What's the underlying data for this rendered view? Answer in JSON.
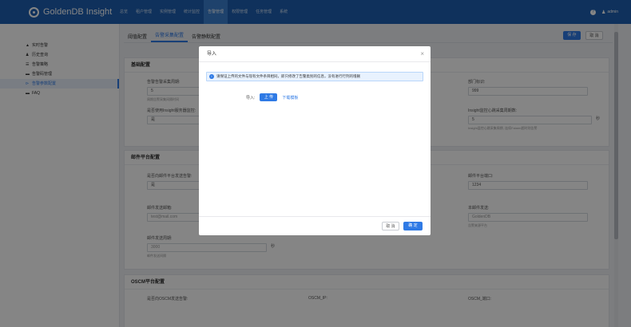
{
  "app": {
    "title": "GoldenDB Insight"
  },
  "nav": {
    "items": [
      {
        "label": "总览"
      },
      {
        "label": "租户管理"
      },
      {
        "label": "实例管理"
      },
      {
        "label": "统计监控"
      },
      {
        "label": "告警管理"
      },
      {
        "label": "权限管理"
      },
      {
        "label": "任务管理"
      },
      {
        "label": "系统"
      }
    ],
    "active_index": 4
  },
  "user": {
    "name": "admin"
  },
  "sidebar": {
    "items": [
      {
        "icon": "▲",
        "label": "实时告警"
      },
      {
        "icon": "♟",
        "label": "历史查询"
      },
      {
        "icon": "☰",
        "label": "告警策略"
      },
      {
        "icon": "▬",
        "label": "告警码管理"
      },
      {
        "icon": "⊳",
        "label": "告警参数配置"
      },
      {
        "icon": "▬",
        "label": "FAQ"
      }
    ],
    "active_index": 4
  },
  "tabs": {
    "items": [
      {
        "label": "阈值配置"
      },
      {
        "label": "告警采集配置"
      },
      {
        "label": "告警静默配置"
      }
    ],
    "active_index": 1
  },
  "toolbar": {
    "save_label": "保 存",
    "cancel_label": "取 消"
  },
  "basic": {
    "title": "基础配置",
    "f1": {
      "label": "告警告警采集周期:",
      "value": "5",
      "hint": "周期告警采集间隔时间"
    },
    "f2": {
      "label": "部门标识:",
      "value": "999"
    },
    "f3": {
      "label": "是否使用Insight服务器监控:",
      "value": "是"
    },
    "f4": {
      "label": "Insight监控心跳采集周期数:",
      "value": "5",
      "unit": "秒",
      "hint": "Insight监控心跳采集周期, 连续Falarm超时则告警"
    }
  },
  "mail": {
    "title": "邮件平台配置",
    "f1": {
      "label": "是否向邮件平台发送告警:",
      "value": "是"
    },
    "f2": {
      "label": "邮件平台端口:",
      "value": "1234"
    },
    "f3": {
      "label": "邮件发送邮箱:",
      "value": "test@mail.com"
    },
    "f4": {
      "label": "本邮件发送:",
      "value": "GoldenDB",
      "hint": "告警来源平台"
    },
    "f5": {
      "label": "邮件发送周期:",
      "value": "3000",
      "unit": "秒",
      "hint": "邮件发送间隔"
    }
  },
  "oscm": {
    "title": "OSCM平台配置",
    "f1": {
      "label": "是否向OSCM发送告警:"
    },
    "f2": {
      "label": "OSCM_IP:"
    },
    "f3": {
      "label": "OSCM_端口:"
    }
  },
  "modal": {
    "title": "导入",
    "alert": "请保证上传的文件与现有文件条目相同，即只修改了告警类别的信息，没有进行行列的增删",
    "import_label": "导入:",
    "upload_label": "上 传",
    "template_link": "下载模板",
    "cancel_label": "取 消",
    "ok_label": "确 定"
  },
  "colors": {
    "primary": "#2f7ae5",
    "topbar": "#1d5fb0"
  }
}
